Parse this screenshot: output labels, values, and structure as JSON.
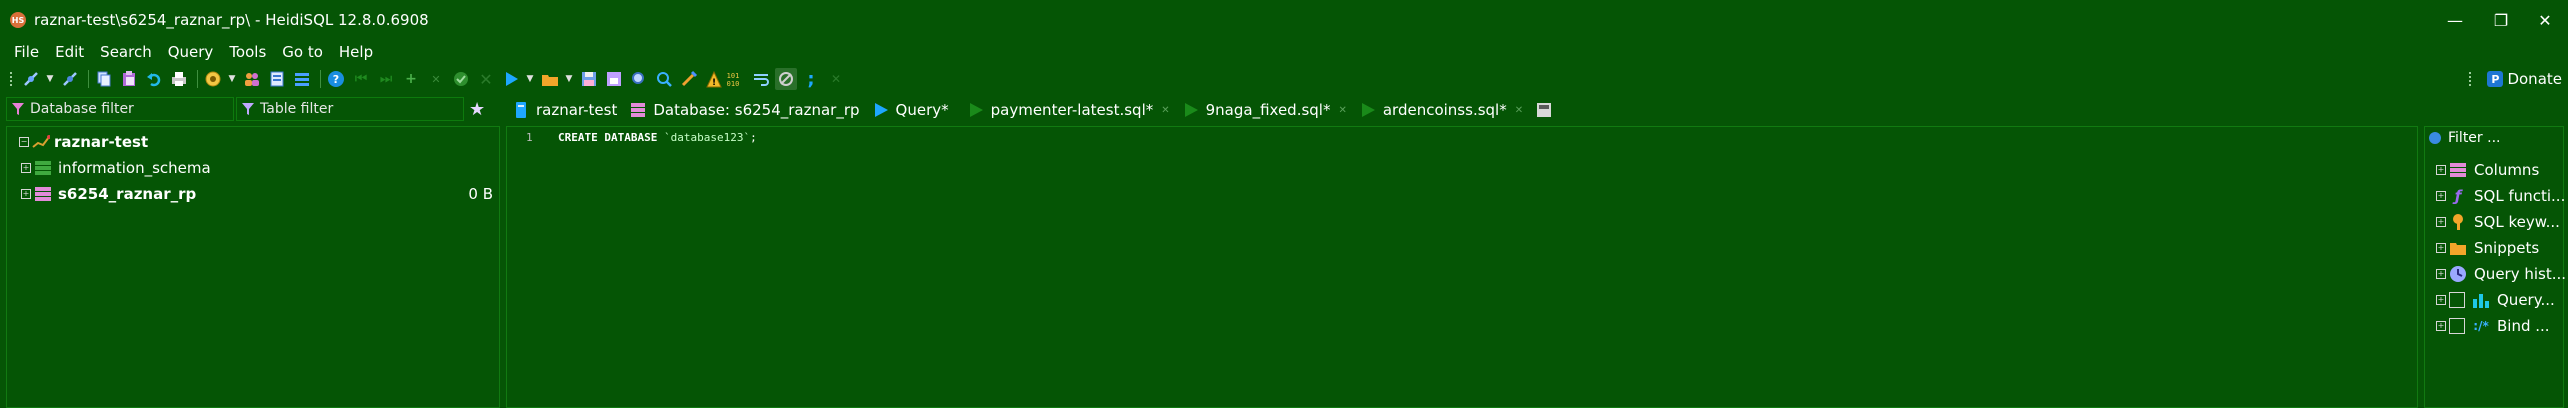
{
  "window": {
    "title": "raznar-test\\s6254_raznar_rp\\ - HeidiSQL 12.8.0.6908",
    "logo_text": "HS",
    "minimize": "—",
    "restore": "❐",
    "close": "✕"
  },
  "menu": [
    "File",
    "Edit",
    "Search",
    "Query",
    "Tools",
    "Go to",
    "Help"
  ],
  "toolbar": {
    "donate_label": "Donate",
    "paypal_glyph": "P"
  },
  "filters": {
    "database_filter": "Database filter",
    "table_filter": "Table filter"
  },
  "tabs": [
    {
      "label": "raznar-test",
      "icon": "server-icon"
    },
    {
      "label": "Database: s6254_raznar_rp",
      "icon": "database-icon"
    },
    {
      "label": "Query*",
      "icon": "play-icon"
    },
    {
      "label": "paymenter-latest.sql*",
      "icon": "play-icon"
    },
    {
      "label": "9naga_fixed.sql*",
      "icon": "play-icon"
    },
    {
      "label": "ardencoinss.sql*",
      "icon": "play-icon"
    }
  ],
  "tree": {
    "server": "raznar-test",
    "databases": [
      {
        "name": "information_schema",
        "size": ""
      },
      {
        "name": "s6254_raznar_rp",
        "size": "0 B"
      }
    ]
  },
  "editor": {
    "line_number": "1",
    "keyword": "CREATE DATABASE",
    "identifier": "`database123`",
    "terminator": ";"
  },
  "helpers": {
    "filter_placeholder": "Filter ...",
    "items": [
      {
        "label": "Columns",
        "icon": "columns-icon"
      },
      {
        "label": "SQL functi...",
        "icon": "function-icon"
      },
      {
        "label": "SQL keyw...",
        "icon": "key-icon"
      },
      {
        "label": "Snippets",
        "icon": "folder-icon"
      },
      {
        "label": "Query hist...",
        "icon": "clock-icon"
      },
      {
        "label": "Query...",
        "icon": "chart-icon"
      },
      {
        "label": "Bind ...",
        "icon": "bind-icon"
      }
    ]
  },
  "colors": {
    "background": "#055505",
    "accent_blue": "#1ea7ff",
    "database_pink": "#e28bd8",
    "folder_orange": "#f3a52a"
  }
}
